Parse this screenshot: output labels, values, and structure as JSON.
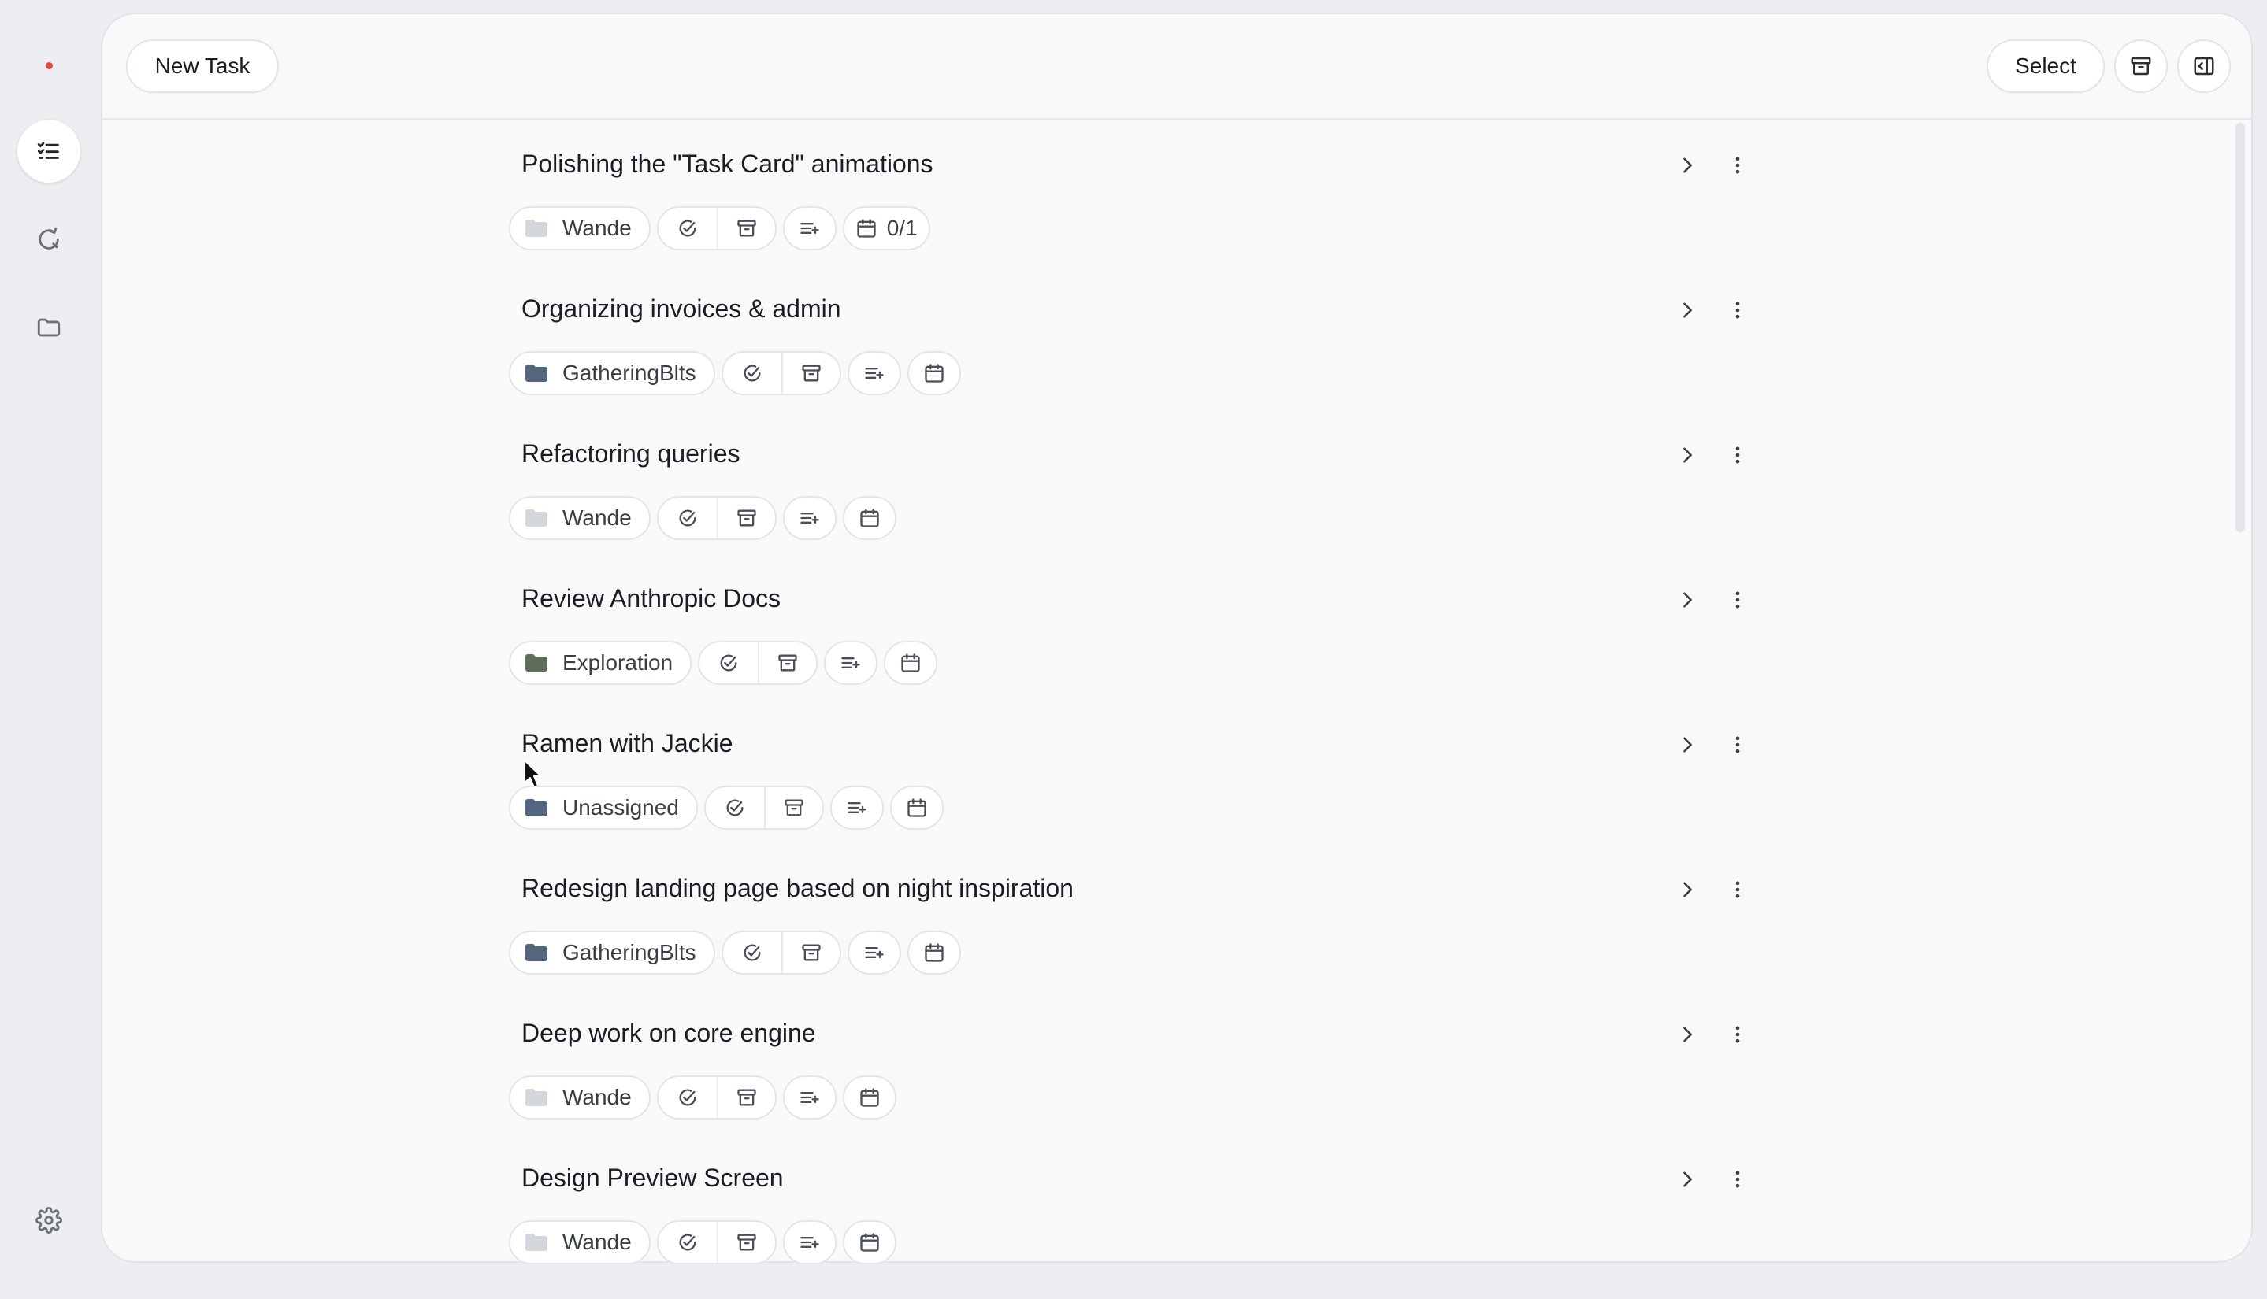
{
  "toolbar": {
    "new_task_label": "New Task",
    "select_label": "Select"
  },
  "colors": {
    "folder_light": "#d3d6da",
    "folder_slate": "#55677f",
    "folder_green": "#5d6f58",
    "notification_dot": "#e5483c"
  },
  "tasks": [
    {
      "title": "Polishing the \"Task Card\" animations",
      "folder": "Wande",
      "folder_color": "#d3d6da",
      "date_badge": "0/1"
    },
    {
      "title": "Organizing invoices & admin",
      "folder": "GatheringBlts",
      "folder_color": "#55677f",
      "date_badge": ""
    },
    {
      "title": "Refactoring queries",
      "folder": "Wande",
      "folder_color": "#d3d6da",
      "date_badge": ""
    },
    {
      "title": "Review Anthropic Docs",
      "folder": "Exploration",
      "folder_color": "#5d6f58",
      "date_badge": ""
    },
    {
      "title": "Ramen with Jackie",
      "folder": "Unassigned",
      "folder_color": "#55677f",
      "date_badge": ""
    },
    {
      "title": "Redesign landing page based on night inspiration",
      "folder": "GatheringBlts",
      "folder_color": "#55677f",
      "date_badge": ""
    },
    {
      "title": "Deep work on core engine",
      "folder": "Wande",
      "folder_color": "#d3d6da",
      "date_badge": ""
    },
    {
      "title": "Design Preview Screen",
      "folder": "Wande",
      "folder_color": "#d3d6da",
      "date_badge": ""
    }
  ]
}
